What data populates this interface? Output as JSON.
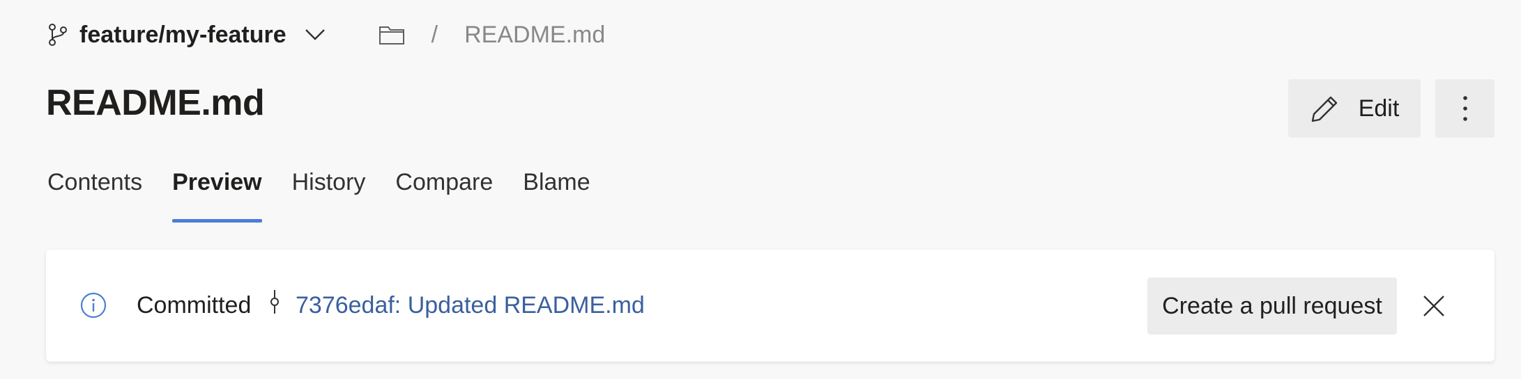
{
  "breadcrumb": {
    "branch_icon": "git-branch-icon",
    "branch_name": "feature/my-feature",
    "branch_dropdown_icon": "chevron-down-icon",
    "folder_icon": "folder-icon",
    "separator": "/",
    "file_name": "README.md"
  },
  "page": {
    "title": "README.md"
  },
  "actions": {
    "edit_label": "Edit",
    "edit_icon": "pencil-icon",
    "more_icon": "more-vertical-icon"
  },
  "tabs": [
    {
      "label": "Contents",
      "active": false
    },
    {
      "label": "Preview",
      "active": true
    },
    {
      "label": "History",
      "active": false
    },
    {
      "label": "Compare",
      "active": false
    },
    {
      "label": "Blame",
      "active": false
    }
  ],
  "commit_notice": {
    "info_icon": "info-icon",
    "status_label": "Committed",
    "commit_icon": "git-commit-icon",
    "commit_link": "7376edaf: Updated README.md",
    "create_pr_label": "Create a pull request",
    "close_icon": "close-icon"
  },
  "colors": {
    "background": "#f8f8f8",
    "accent": "#4a7ed6",
    "link": "#3a5f9e",
    "button_background": "#ececec"
  }
}
